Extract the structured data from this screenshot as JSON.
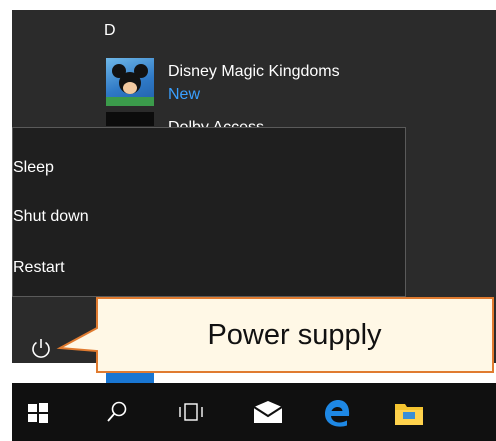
{
  "start_menu": {
    "group_letter": "D",
    "apps": [
      {
        "name": "Disney Magic Kingdoms",
        "badge": "New",
        "icon": "disney-magic-kingdoms-icon"
      },
      {
        "name": "Dolby Access",
        "icon": "dolby-access-icon"
      }
    ]
  },
  "power_menu": {
    "items": [
      {
        "label": "Sleep"
      },
      {
        "label": "Shut down"
      },
      {
        "label": "Restart"
      }
    ],
    "power_icon": "power-icon"
  },
  "callout": {
    "text": "Power supply",
    "fill": "#fff8e6",
    "stroke": "#e07b30"
  },
  "taskbar": {
    "icons": [
      "windows-start-icon",
      "search-icon",
      "task-view-icon",
      "mail-icon",
      "edge-icon",
      "file-explorer-icon"
    ]
  },
  "colors": {
    "panel": "#2b2b2b",
    "accent": "#3aa0ff"
  }
}
